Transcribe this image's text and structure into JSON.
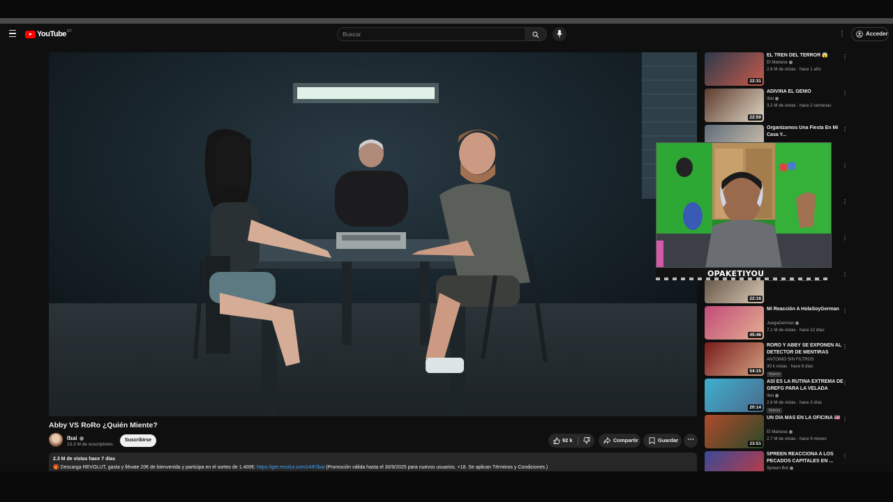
{
  "masthead": {
    "logo_text": "YouTube",
    "logo_country": "GT",
    "search_placeholder": "Buscar",
    "signin_label": "Acceder"
  },
  "video": {
    "title": "Abby VS RoRo ¿Quién Miente?",
    "channel": "Ibai",
    "subscribers": "13.3 M de suscriptores",
    "subscribe_label": "Suscribirse",
    "likes": "92 k",
    "share_label": "Compartir",
    "save_label": "Guardar",
    "more_label": "⋯"
  },
  "description": {
    "stats": "2.3 M de vistas  hace 7 días",
    "text_prefix": "🎁 Descarga REVOLUT, gasta y llévate 20€ de bienvenida y participa en el sorteo de 1.400€: ",
    "link": "https://get.revolut.com/z4IF/ibai",
    "text_suffix": " (Promoción válida hasta el 30/9/2025 para nuevos usuarios. +18. Se aplican Términos y Condiciones.)"
  },
  "webcam": {
    "name": "OPAKETIYOU"
  },
  "recommendations": [
    {
      "title": "EL TREN DEL TERROR 😱",
      "channel": "El Mariana",
      "meta": "2.6 M de vistas · hace 1 año",
      "duration": "22:31",
      "verified": true,
      "badge": ""
    },
    {
      "title": "ADIVINA EL GENIO",
      "channel": "Ibai",
      "meta": "3.2 M de vistas · hace 2 semanas",
      "duration": "22:50",
      "verified": true,
      "badge": ""
    },
    {
      "title": "Organizamos Una Fiesta En Mi Casa Y...",
      "channel": "",
      "meta": "",
      "duration": "",
      "verified": false,
      "badge": ""
    },
    {
      "title": "",
      "channel": "",
      "meta": "",
      "duration": "",
      "verified": false,
      "badge": ""
    },
    {
      "title": "",
      "channel": "",
      "meta": "",
      "duration": "",
      "verified": false,
      "badge": ""
    },
    {
      "title": "",
      "channel": "",
      "meta": "",
      "duration": "",
      "verified": false,
      "badge": ""
    },
    {
      "title": "",
      "channel": "Ibai",
      "meta": "4.8 M de vistas · hace 1 mes",
      "duration": "22:16",
      "verified": true,
      "badge": ""
    },
    {
      "title": "Mi Reacción A HolaSoyGerman",
      "channel": "JuegaGerman",
      "meta": "7.1 M de vistas · hace 12 días",
      "duration": "45:46",
      "verified": true,
      "badge": ""
    },
    {
      "title": "RORO Y ABBY SE EXPONEN AL DETECTOR DE MENTIRAS",
      "channel": "ANTONIO SIN FILTROS",
      "meta": "30 k vistas · hace 6 días",
      "duration": "54:15",
      "verified": false,
      "badge": "Nuevo"
    },
    {
      "title": "ASÍ ES LA RUTINA EXTREMA DE GREFG PARA LA VELADA",
      "channel": "Ibai",
      "meta": "2.6 M de vistas · hace 3 días",
      "duration": "20:14",
      "verified": true,
      "badge": "Nuevo"
    },
    {
      "title": "UN DÍA MAS EN LA OFICINA 🇺🇸",
      "channel": "El Mariana",
      "meta": "2.7 M de vistas · hace 9 meses",
      "duration": "23:51",
      "verified": true,
      "badge": ""
    },
    {
      "title": "SPREEN REACCIONA A LOS PECADOS CAPITALES EN ...",
      "channel": "Spreen Bot",
      "meta": "",
      "duration": "",
      "verified": true,
      "badge": ""
    }
  ],
  "icons": [
    "menu-icon",
    "youtube-logo-icon",
    "search-icon",
    "mic-icon",
    "more-vert-icon",
    "account-icon",
    "like-icon",
    "dislike-icon",
    "share-icon",
    "save-icon"
  ],
  "colors": {
    "background": "#0f0f0f",
    "accent": "#ff0000",
    "link": "#3ea6ff",
    "button": "#272727"
  }
}
